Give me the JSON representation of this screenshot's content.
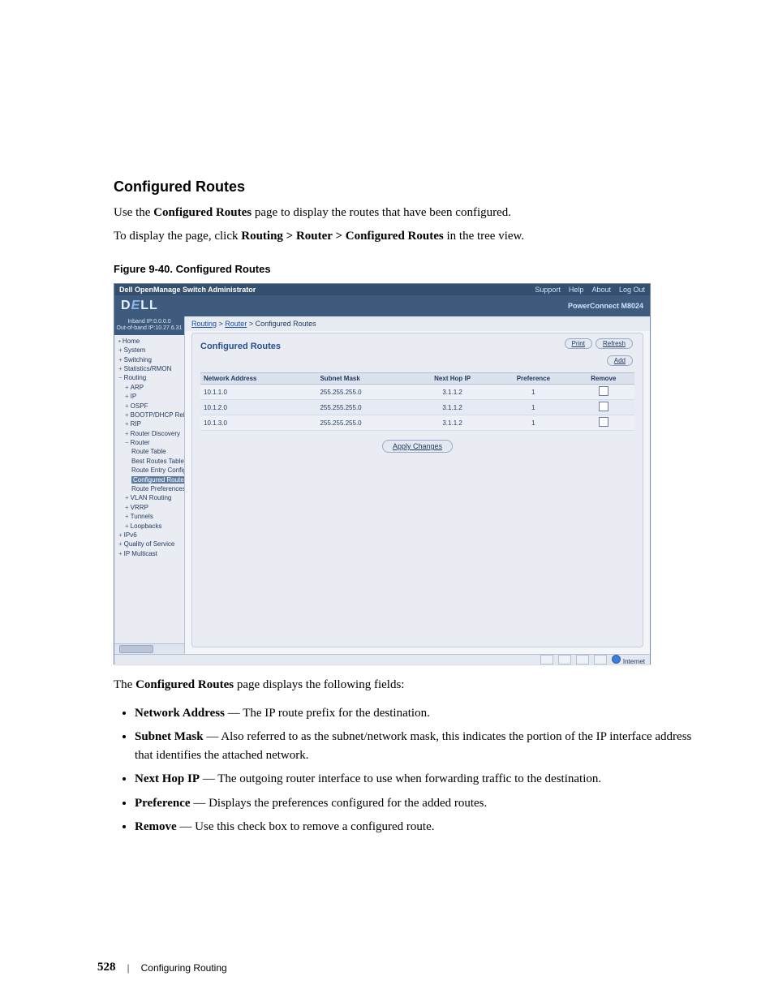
{
  "section_title": "Configured Routes",
  "intro_line1_pre": "Use the ",
  "intro_line1_bold": "Configured Routes",
  "intro_line1_post": " page to display the routes that have been configured.",
  "intro_line2_pre": "To display the page, click ",
  "intro_line2_bold": "Routing > Router > Configured Routes",
  "intro_line2_post": " in the tree view.",
  "figure_caption": "Figure 9-40.    Configured Routes",
  "app": {
    "title": "Dell OpenManage Switch Administrator",
    "link_support": "Support",
    "link_help": "Help",
    "link_about": "About",
    "link_logout": "Log Out",
    "brand": "DELL",
    "product": "PowerConnect M8024",
    "ip_inband": "Inband IP:0.0.0.0",
    "ip_outband": "Out-of-band IP:10.27.6.31",
    "tree": {
      "home": "Home",
      "system": "System",
      "switching": "Switching",
      "stats": "Statistics/RMON",
      "routing": "Routing",
      "arp": "ARP",
      "ip": "IP",
      "ospf": "OSPF",
      "bootp": "BOOTP/DHCP Relay A",
      "rip": "RIP",
      "router_disc": "Router Discovery",
      "router": "Router",
      "route_table": "Route Table",
      "best_routes": "Best Routes Table",
      "route_entry": "Route Entry Config",
      "configured_routes": "Configured Routes",
      "route_prefs": "Route Preferences",
      "vlan_routing": "VLAN Routing",
      "vrrp": "VRRP",
      "tunnels": "Tunnels",
      "loopbacks": "Loopbacks",
      "ipv6": "IPv6",
      "qos": "Quality of Service",
      "ip_multicast": "IP Multicast"
    },
    "crumb_routing": "Routing",
    "crumb_router": "Router",
    "crumb_leaf": "Configured Routes",
    "panel_title": "Configured Routes",
    "btn_print": "Print",
    "btn_refresh": "Refresh",
    "btn_add": "Add",
    "btn_apply": "Apply Changes",
    "status_text": "Internet",
    "columns": {
      "net": "Network Address",
      "mask": "Subnet Mask",
      "hop": "Next Hop IP",
      "pref": "Preference",
      "remove": "Remove"
    },
    "rows": [
      {
        "net": "10.1.1.0",
        "mask": "255.255.255.0",
        "hop": "3.1.1.2",
        "pref": "1"
      },
      {
        "net": "10.1.2.0",
        "mask": "255.255.255.0",
        "hop": "3.1.1.2",
        "pref": "1"
      },
      {
        "net": "10.1.3.0",
        "mask": "255.255.255.0",
        "hop": "3.1.1.2",
        "pref": "1"
      }
    ]
  },
  "after_figure_intro_pre": "The ",
  "after_figure_intro_bold": "Configured Routes",
  "after_figure_intro_post": " page displays the following fields:",
  "fields": [
    {
      "term": "Network Address",
      "desc": " — The IP route prefix for the destination."
    },
    {
      "term": "Subnet Mask",
      "desc": " — Also referred to as the subnet/network mask, this indicates the portion of the IP interface address that identifies the attached network."
    },
    {
      "term": "Next Hop IP",
      "desc": " — The outgoing router interface to use when forwarding traffic to the destination."
    },
    {
      "term": "Preference",
      "desc": " — Displays the preferences configured for the added routes."
    },
    {
      "term": "Remove",
      "desc": " — Use this check box to remove a configured route."
    }
  ],
  "footer": {
    "page_number": "528",
    "chapter": "Configuring Routing"
  }
}
